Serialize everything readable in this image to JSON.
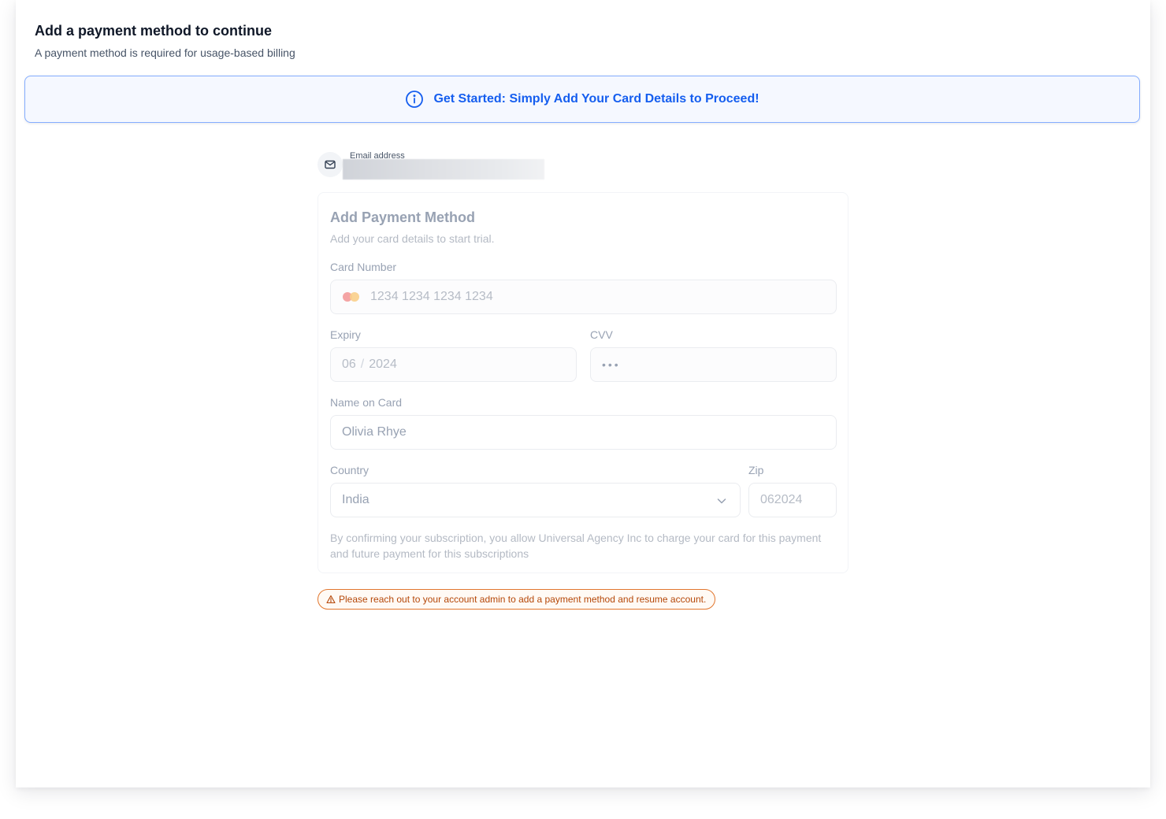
{
  "header": {
    "title": "Add a payment method to continue",
    "subtitle": "A payment method is required for usage-based billing"
  },
  "banner": {
    "icon": "info-icon",
    "text": "Get Started: Simply Add Your Card Details to Proceed!",
    "color": "#155eef"
  },
  "email": {
    "icon": "mail-icon",
    "label": "Email address",
    "value": ""
  },
  "form": {
    "title": "Add Payment Method",
    "subtitle": "Add your card details to start trial.",
    "card_number": {
      "label": "Card Number",
      "placeholder": "1234 1234 1234 1234",
      "icon": "mastercard-icon"
    },
    "expiry": {
      "label": "Expiry",
      "month": "06",
      "separator": "/",
      "year": "2024"
    },
    "cvv": {
      "label": "CVV",
      "value": "•••"
    },
    "name_on_card": {
      "label": "Name on Card",
      "value": "Olivia Rhye"
    },
    "country": {
      "label": "Country",
      "value": "India",
      "icon": "chevron-down-icon"
    },
    "zip": {
      "label": "Zip",
      "value": "062024"
    },
    "legal_text": "By confirming your subscription, you allow Universal Agency Inc to charge your card for this payment and future payment for this subscriptions"
  },
  "warning": {
    "icon": "alert-triangle-icon",
    "text": "Please reach out to your account admin to add a payment method and resume account.",
    "color": "#b54708"
  }
}
